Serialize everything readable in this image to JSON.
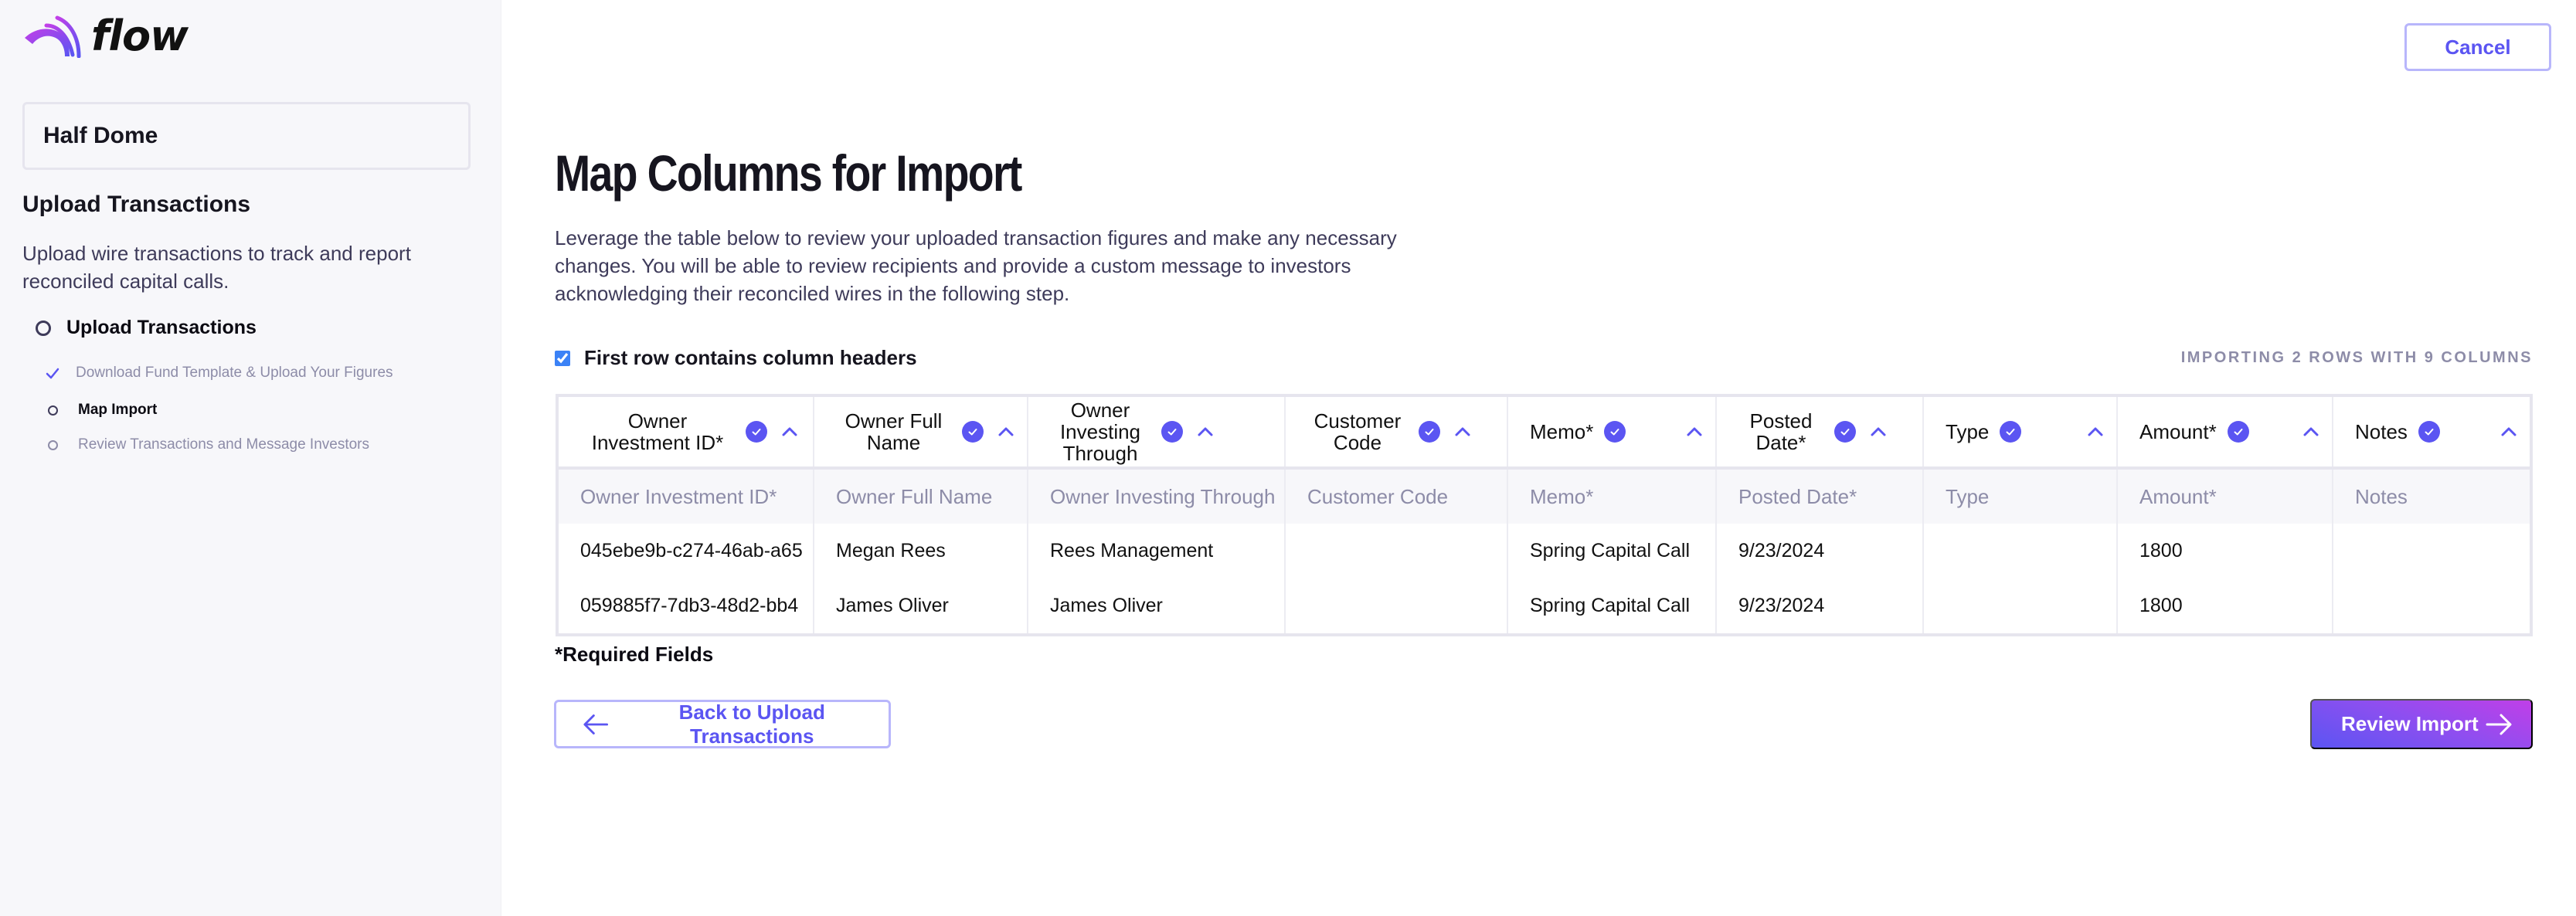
{
  "app": {
    "logo_text": "flow"
  },
  "sidebar": {
    "fund_name": "Half Dome",
    "section_title": "Upload Transactions",
    "description": "Upload wire transactions to track and report reconciled capital calls.",
    "steps": [
      {
        "label": "Upload Transactions",
        "status": "in-progress",
        "substeps": [
          {
            "label": "Download Fund Template & Upload Your Figures",
            "status": "complete"
          },
          {
            "label": "Map Import",
            "status": "current"
          },
          {
            "label": "Review Transactions and Message Investors",
            "status": "pending"
          }
        ]
      }
    ]
  },
  "header": {
    "cancel_label": "Cancel"
  },
  "main": {
    "title": "Map Columns for Import",
    "intro": "Leverage the table below to review your uploaded transaction figures and make any necessary changes. You will be able to review recipients and provide a custom message to investors acknowledging their reconciled wires in the following step.",
    "first_row_header_label": "First row contains column headers",
    "first_row_header_checked": true,
    "import_summary": "IMPORTING 2 ROWS WITH 9 COLUMNS",
    "required_note": "*Required Fields",
    "back_label": "Back to Upload Transactions",
    "review_label": "Review Import",
    "accent_color": "#5b55f2"
  },
  "table": {
    "columns": [
      {
        "label": "Owner Investment ID*",
        "source": "Owner Investment ID*",
        "mapped": true
      },
      {
        "label": "Owner Full Name",
        "source": "Owner Full Name",
        "mapped": true
      },
      {
        "label": "Owner Investing Through",
        "source": "Owner Investing Through",
        "mapped": true
      },
      {
        "label": "Customer Code",
        "source": "Customer Code",
        "mapped": true
      },
      {
        "label": "Memo*",
        "source": "Memo*",
        "mapped": true
      },
      {
        "label": "Posted Date*",
        "source": "Posted Date*",
        "mapped": true
      },
      {
        "label": "Type",
        "source": "Type",
        "mapped": true
      },
      {
        "label": "Amount*",
        "source": "Amount*",
        "mapped": true
      },
      {
        "label": "Notes",
        "source": "Notes",
        "mapped": true
      }
    ],
    "rows": [
      [
        "045ebe9b-c274-46ab-a65",
        "Megan Rees",
        "Rees Management",
        "",
        "Spring Capital Call",
        "9/23/2024",
        "",
        "1800",
        ""
      ],
      [
        "059885f7-7db3-48d2-bb4",
        "James Oliver",
        "James Oliver",
        "",
        "Spring Capital Call",
        "9/23/2024",
        "",
        "1800",
        ""
      ]
    ]
  }
}
